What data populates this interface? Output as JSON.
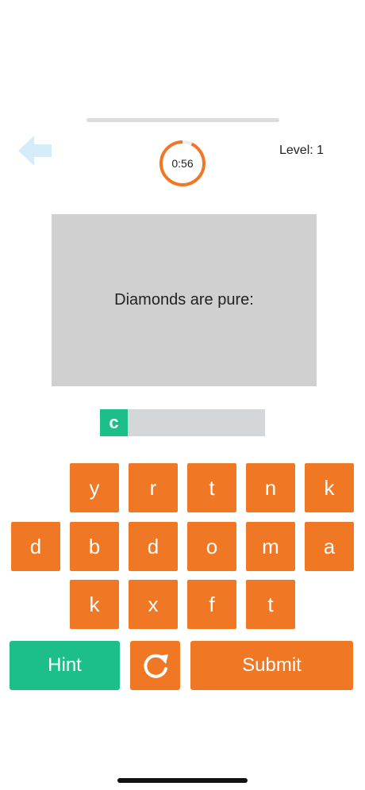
{
  "timer": {
    "text": "0:56",
    "remaining_fraction": 0.93,
    "color": "#f07724"
  },
  "level": {
    "label": "Level: 1"
  },
  "question": {
    "text": "Diamonds are pure:"
  },
  "answer": {
    "letters": [
      "c"
    ]
  },
  "keyboard": {
    "row1": [
      "y",
      "r",
      "t",
      "n",
      "k"
    ],
    "row2": [
      "d",
      "b",
      "d",
      "o",
      "m",
      "a"
    ],
    "row3": [
      "k",
      "x",
      "f",
      "t"
    ]
  },
  "buttons": {
    "hint": "Hint",
    "submit": "Submit"
  },
  "icons": {
    "back": "left-arrow-icon",
    "shuffle": "refresh-icon"
  },
  "colors": {
    "key": "#f07724",
    "hint": "#1cbf8a",
    "back_arrow": "#d6ecfa"
  }
}
